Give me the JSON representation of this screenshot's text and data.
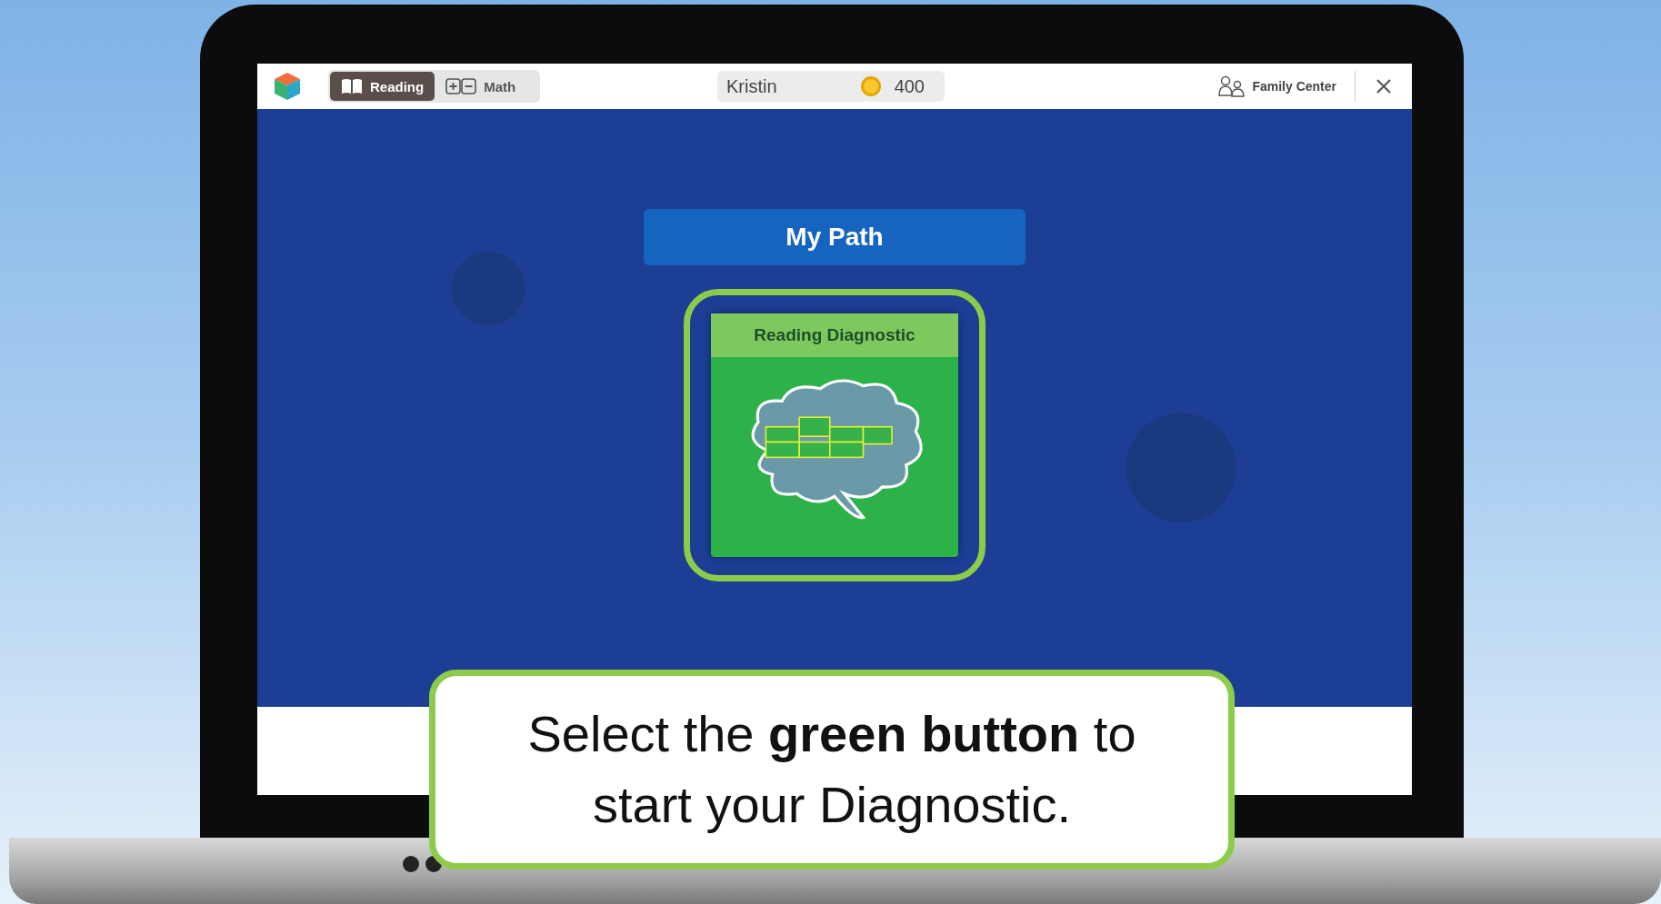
{
  "top_bar": {
    "tabs": [
      {
        "label": "Reading",
        "kind": "book",
        "selected": true
      },
      {
        "label": "Math",
        "kind": "plus-minus",
        "selected": false
      }
    ],
    "user": {
      "name": "Kristin",
      "coins": "400"
    },
    "family_center": "Family Center"
  },
  "main": {
    "title": "My Path",
    "card": {
      "title": "Reading Diagnostic"
    }
  },
  "callout": {
    "text": "Select the **green button** to start your Diagnostic."
  }
}
